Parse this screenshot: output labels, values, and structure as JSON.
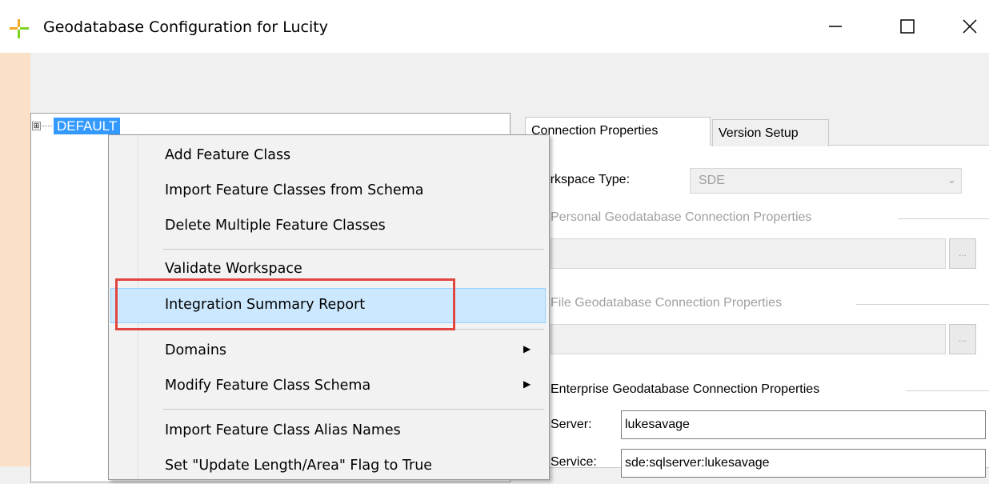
{
  "window": {
    "title": "Geodatabase Configuration for Lucity"
  },
  "tree": {
    "expander": "⊞",
    "root_label": "DEFAULT"
  },
  "tabs": [
    {
      "label": "Connection Properties"
    },
    {
      "label": "Version Setup"
    }
  ],
  "workspace": {
    "type_label": "Workspace Type:",
    "type_value": "SDE"
  },
  "groups": {
    "personal": "Personal Geodatabase Connection Properties",
    "file": "File Geodatabase Connection Properties",
    "enterprise": "Enterprise Geodatabase Connection Properties"
  },
  "browse_label": "...",
  "enterprise": {
    "server_label": "Server:",
    "server_value": "lukesavage",
    "service_label": "Service:",
    "service_value": "sde:sqlserver:lukesavage"
  },
  "context_menu": {
    "items": [
      {
        "label": "Add Feature Class"
      },
      {
        "label": "Import Feature Classes from Schema"
      },
      {
        "label": "Delete Multiple Feature Classes"
      },
      {
        "label": "Validate Workspace"
      },
      {
        "label": "Integration Summary Report"
      },
      {
        "label": "Domains"
      },
      {
        "label": "Modify Feature Class Schema"
      },
      {
        "label": "Import Feature Class Alias Names"
      },
      {
        "label": "Set \"Update Length/Area\" Flag to True"
      }
    ]
  },
  "colors": {
    "selection": "#3399ff",
    "menu_hover": "#cce8ff",
    "annotation": "#e0453f"
  }
}
